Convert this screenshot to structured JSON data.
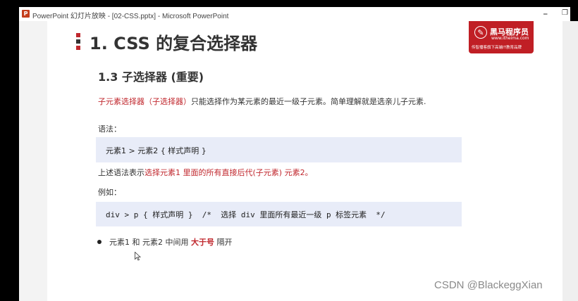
{
  "window": {
    "app_icon": "powerpoint-icon",
    "title": "PowerPoint 幻灯片放映 - [02-CSS.pptx] - Microsoft PowerPoint",
    "minimize_glyph": "⎯",
    "restore_glyph": "❐"
  },
  "slide": {
    "title": "1. CSS 的复合选择器",
    "title_bar_colors": [
      "#c0272d",
      "#333333",
      "#c0272d"
    ],
    "logo": {
      "mark": "✎",
      "name": "黑马程序员",
      "url": "www.itheima.com",
      "slogan": "传智播客旗下高端IT教育品牌"
    },
    "subheading": "1.3 子选择器 (重要)",
    "definition": {
      "highlight": "子元素选择器（子选择器）",
      "rest": "只能选择作为某元素的最近一级子元素。简单理解就是选亲儿子元素."
    },
    "syntax_label": "语法：",
    "syntax_code": "元素1 > 元素2 { 样式声明 }",
    "explain": {
      "prefix": "上述语法表示",
      "highlight": "选择元素1 里面的所有直接后代(子元素) 元素2。"
    },
    "example_label": "例如：",
    "example_code": "div > p { 样式声明 }  /*  选择 div 里面所有最近一级 p 标签元素  */",
    "bullet": {
      "prefix": "元素1 和 元素2 中间用",
      "highlight": "大于号",
      "suffix": "隔开"
    }
  },
  "watermark": "CSDN @BlackeggXian",
  "colors": {
    "accent_red": "#c0272d",
    "code_bg": "#e8ecf8",
    "ppt_icon": "#c43e1c"
  }
}
